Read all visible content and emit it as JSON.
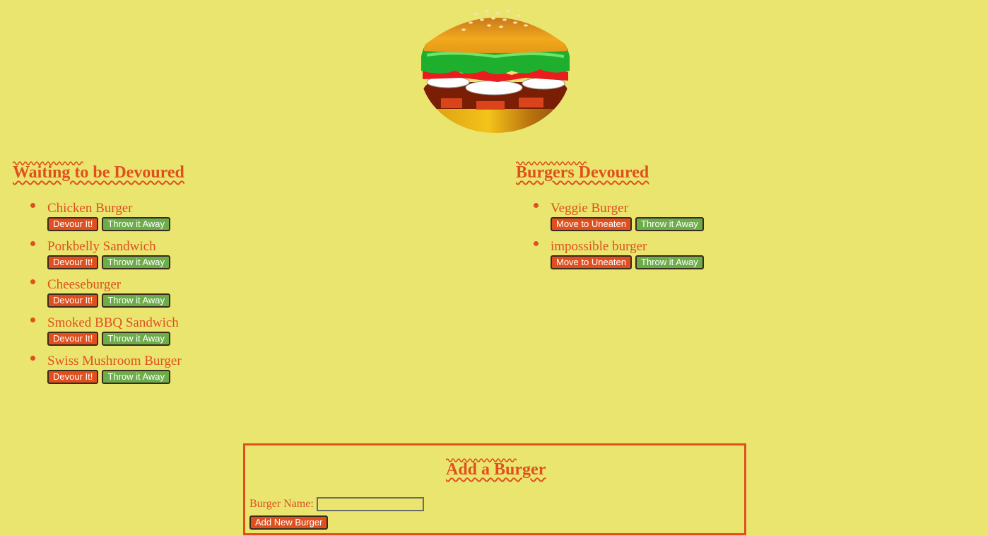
{
  "colors": {
    "background": "#EAE56E",
    "accent": "#E0501F",
    "green_button": "#6CAD4A"
  },
  "logo": {
    "icon": "burger-logo-icon"
  },
  "waiting": {
    "title": "Waiting to be Devoured",
    "devour_label": "Devour It!",
    "throw_label": "Throw it Away",
    "items": [
      {
        "name": "Chicken Burger"
      },
      {
        "name": "Porkbelly Sandwich"
      },
      {
        "name": "Cheeseburger"
      },
      {
        "name": "Smoked BBQ Sandwich"
      },
      {
        "name": "Swiss Mushroom Burger"
      }
    ]
  },
  "devoured": {
    "title": "Burgers Devoured",
    "uneaten_label": "Move to Uneaten",
    "throw_label": "Throw it Away",
    "items": [
      {
        "name": "Veggie Burger"
      },
      {
        "name": "impossible burger"
      }
    ]
  },
  "add_form": {
    "title": "Add a Burger",
    "name_label": "Burger Name:",
    "name_value": "",
    "submit_label": "Add New Burger"
  }
}
